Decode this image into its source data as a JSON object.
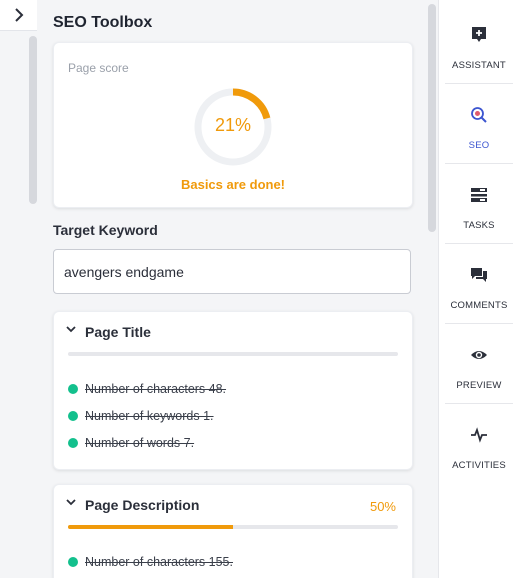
{
  "panel": {
    "title": "SEO Toolbox"
  },
  "score": {
    "label": "Page score",
    "value_text": "21%",
    "value": 21,
    "status": "Basics are done!",
    "color": "#f09a0b"
  },
  "keyword": {
    "label": "Target Keyword",
    "value": "avengers endgame"
  },
  "sections": {
    "title": {
      "label": "Page Title",
      "progress_pct": 0,
      "items": [
        "Number of characters 48.",
        "Number of keywords 1.",
        "Number of words 7."
      ]
    },
    "description": {
      "label": "Page Description",
      "percent_text": "50%",
      "progress_pct": 50,
      "items": [
        "Number of characters 155."
      ]
    }
  },
  "rail": {
    "items": [
      {
        "label": "ASSISTANT",
        "icon": "assistant-icon"
      },
      {
        "label": "SEO",
        "icon": "seo-search-icon",
        "active": true
      },
      {
        "label": "TASKS",
        "icon": "tasks-icon"
      },
      {
        "label": "COMMENTS",
        "icon": "comments-icon"
      },
      {
        "label": "PREVIEW",
        "icon": "eye-icon"
      },
      {
        "label": "ACTIVITIES",
        "icon": "activity-icon"
      }
    ]
  },
  "colors": {
    "accent": "#f09a0b",
    "success": "#13c08d",
    "active": "#3c55d0"
  }
}
